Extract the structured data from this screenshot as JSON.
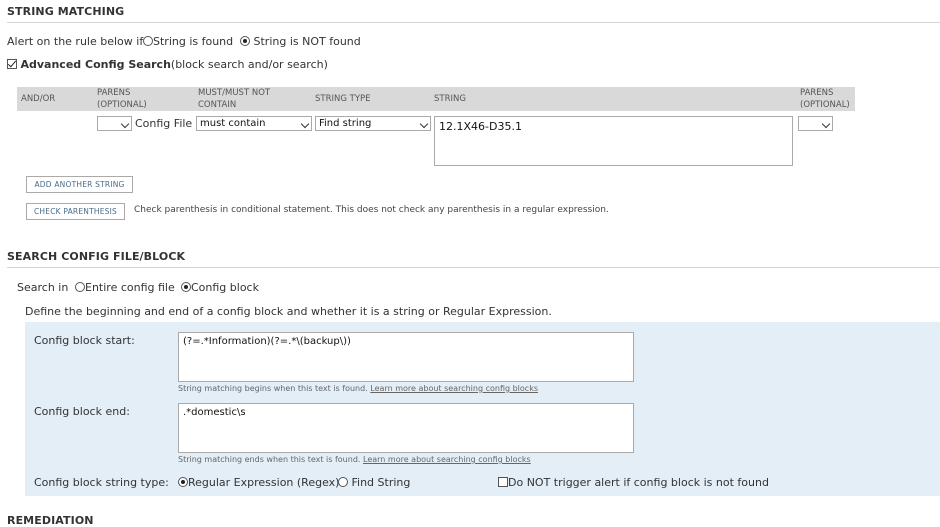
{
  "string_matching": {
    "title": "STRING MATCHING",
    "alert_label": "Alert on the rule below if",
    "option_found": "String is found",
    "option_not_found": "String is NOT found",
    "advanced_label": "Advanced Config Search",
    "advanced_suffix": "(block search and/or search)",
    "columns": {
      "and_or": "AND/OR",
      "parens_open_1": "PARENS",
      "parens_open_2": "(OPTIONAL)",
      "must_1": "MUST/MUST NOT",
      "must_2": "CONTAIN",
      "string_type": "STRING TYPE",
      "string": "STRING",
      "parens_close_1": "PARENS",
      "parens_close_2": "(OPTIONAL)"
    },
    "row": {
      "source": "Config File",
      "must": "must contain",
      "string_type": "Find string",
      "string_value": "12.1X46-D35.1"
    },
    "add_another": "ADD ANOTHER STRING",
    "check_parens": "CHECK PARENTHESIS",
    "check_parens_note": "Check parenthesis in conditional statement. This does not check any parenthesis in a regular expression."
  },
  "search_config": {
    "title": "SEARCH CONFIG FILE/BLOCK",
    "search_in_label": "Search in",
    "option_entire": "Entire config file",
    "option_block": "Config block",
    "define_text": "Define the beginning and end of a config block and whether it is a string or Regular Expression.",
    "block_start_label": "Config block start:",
    "block_start_value": "(?=.*Information)(?=.*\\(backup\\))",
    "block_start_hint": "String matching begins when this text is found.",
    "block_end_label": "Config block end:",
    "block_end_value": ".*domestic\\s",
    "block_end_hint": "String matching ends when this text is found.",
    "learn_more": "Learn more about searching config blocks",
    "string_type_label": "Config block string type:",
    "option_regex": "Regular Expression (Regex)",
    "option_find": "Find String",
    "no_trigger": "Do NOT trigger alert if config block is not found"
  },
  "remediation": {
    "title": "REMEDIATION"
  }
}
